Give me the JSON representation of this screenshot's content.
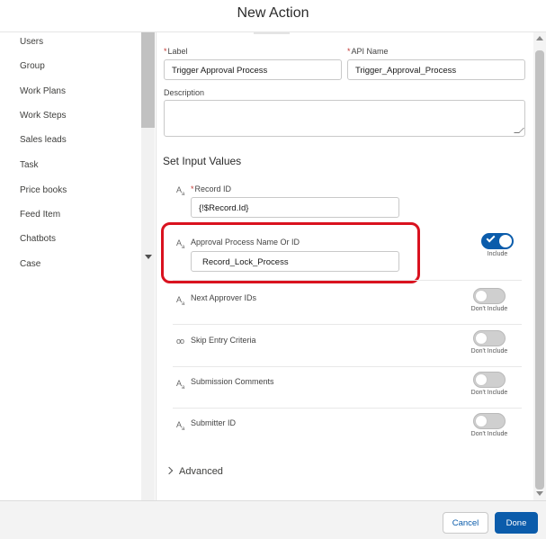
{
  "modal": {
    "title": "New Action"
  },
  "sidebar": {
    "items": [
      "Users",
      "Group",
      "Work Plans",
      "Work Steps",
      "Sales leads",
      "Task",
      "Price books",
      "Feed Item",
      "Chatbots",
      "Case"
    ]
  },
  "form": {
    "label_label": "Label",
    "label_value": "Trigger Approval Process",
    "api_name_label": "API Name",
    "api_name_value": "Trigger_Approval_Process",
    "description_label": "Description",
    "description_value": "",
    "required_mark": "*"
  },
  "inputs_section": {
    "title": "Set Input Values",
    "record_id": {
      "label": "Record ID",
      "value": "{!$Record.Id}"
    },
    "params": [
      {
        "label": "Approval Process Name Or ID",
        "value": "Record_Lock_Process",
        "include": true,
        "toggle_text": "Include",
        "icon": "text-type-icon"
      },
      {
        "label": "Next Approver IDs",
        "include": false,
        "toggle_text": "Don't Include",
        "icon": "text-type-icon"
      },
      {
        "label": "Skip Entry Criteria",
        "include": false,
        "toggle_text": "Don't Include",
        "icon": "boolean-toggle-icon"
      },
      {
        "label": "Submission Comments",
        "include": false,
        "toggle_text": "Don't Include",
        "icon": "text-type-icon"
      },
      {
        "label": "Submitter ID",
        "include": false,
        "toggle_text": "Don't Include",
        "icon": "text-type-icon"
      }
    ],
    "icon_glyph": "A",
    "icon_sub": "a",
    "link_glyph": "oo"
  },
  "advanced": {
    "label": "Advanced"
  },
  "footer": {
    "cancel_label": "Cancel",
    "done_label": "Done"
  },
  "colors": {
    "brand": "#0b5cab",
    "highlight": "#d9121f",
    "required": "#c23934"
  }
}
